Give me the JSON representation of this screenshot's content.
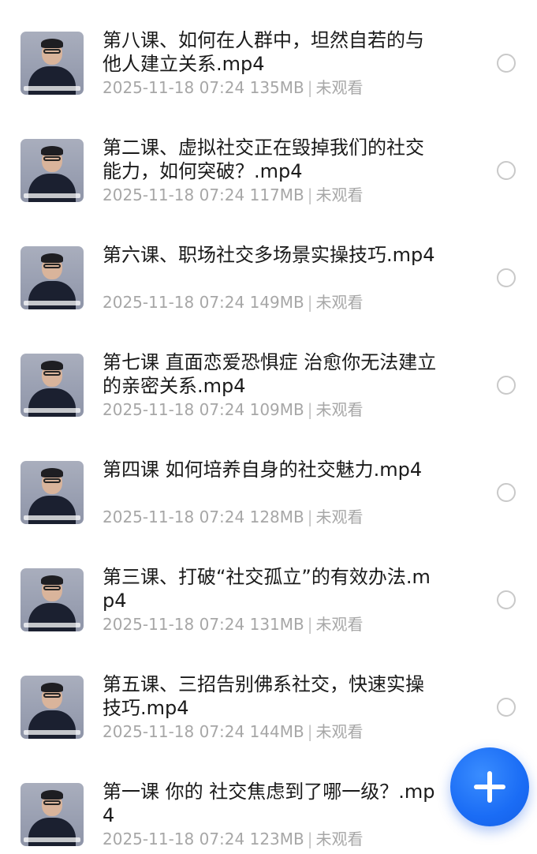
{
  "items": [
    {
      "title": "第八课、如何在人群中，坦然自若的与他人建立关系.mp4",
      "date": "2025-11-18 07:24",
      "size": "135MB",
      "status": "未观看"
    },
    {
      "title": "第二课、虚拟社交正在毁掉我们的社交能力，如何突破？.mp4",
      "date": "2025-11-18 07:24",
      "size": "117MB",
      "status": "未观看"
    },
    {
      "title": "第六课、职场社交多场景实操技巧.mp4",
      "date": "2025-11-18 07:24",
      "size": "149MB",
      "status": "未观看"
    },
    {
      "title": "第七课 直面恋爱恐惧症 治愈你无法建立的亲密关系.mp4",
      "date": "2025-11-18 07:24",
      "size": "109MB",
      "status": "未观看"
    },
    {
      "title": "第四课  如何培养自身的社交魅力.mp4",
      "date": "2025-11-18 07:24",
      "size": "128MB",
      "status": "未观看"
    },
    {
      "title": "第三课、打破“社交孤立”的有效办法.mp4",
      "date": "2025-11-18 07:24",
      "size": "131MB",
      "status": "未观看"
    },
    {
      "title": "第五课、三招告别佛系社交，快速实操技巧.mp4",
      "date": "2025-11-18 07:24",
      "size": "144MB",
      "status": "未观看"
    },
    {
      "title": "第一课 你的 社交焦虑到了哪一级？.mp4",
      "date": "2025-11-18 07:24",
      "size": "123MB",
      "status": "未观看"
    }
  ],
  "icons": {
    "thumbnail": "video-thumbnail",
    "select": "radio-circle",
    "fab": "plus-icon"
  },
  "colors": {
    "fab": "#1a6cf5",
    "meta_text": "#a7a7a7",
    "title_text": "#1a1a1a"
  }
}
